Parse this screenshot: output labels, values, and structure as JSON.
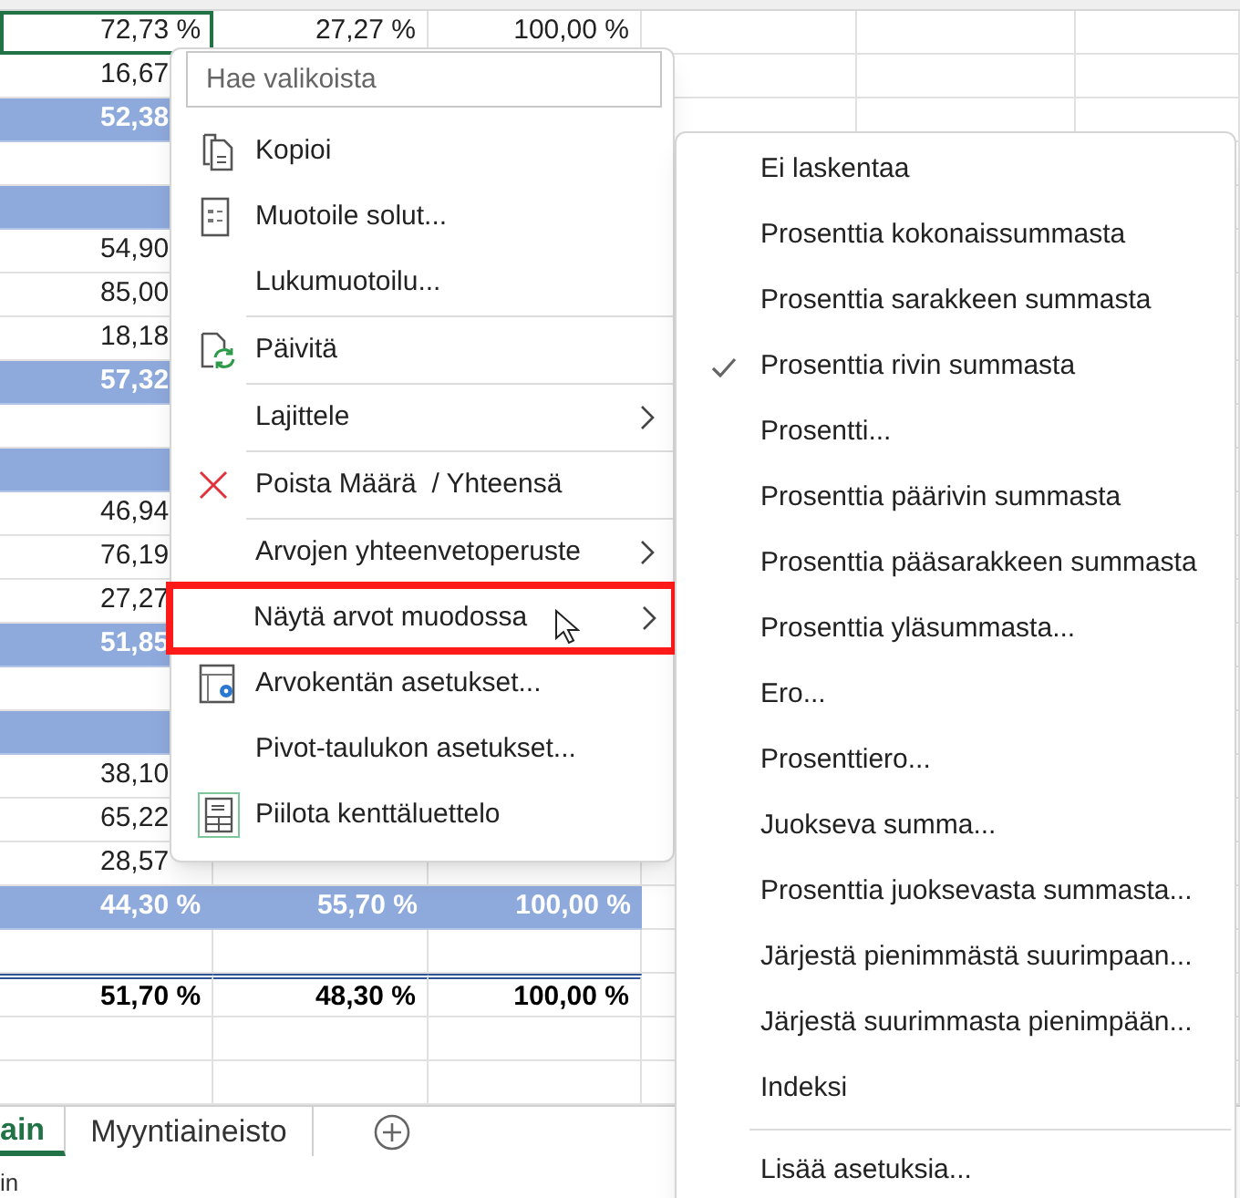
{
  "sheet": {
    "rows": [
      {
        "kind": "value",
        "selected_cell": true,
        "cells": [
          "72,73 %",
          "27,27 %",
          "100,00 %"
        ]
      },
      {
        "kind": "value",
        "cells": [
          "16,67"
        ]
      },
      {
        "kind": "subtotal",
        "cells": [
          "52,38"
        ]
      },
      {
        "kind": "empty",
        "cells": []
      },
      {
        "kind": "header",
        "cells": []
      },
      {
        "kind": "value",
        "cells": [
          "54,90"
        ]
      },
      {
        "kind": "value",
        "cells": [
          "85,00"
        ]
      },
      {
        "kind": "value",
        "cells": [
          "18,18"
        ]
      },
      {
        "kind": "subtotal",
        "cells": [
          "57,32"
        ]
      },
      {
        "kind": "empty",
        "cells": []
      },
      {
        "kind": "header",
        "cells": []
      },
      {
        "kind": "value",
        "cells": [
          "46,94"
        ]
      },
      {
        "kind": "value",
        "cells": [
          "76,19"
        ]
      },
      {
        "kind": "value",
        "cells": [
          "27,27"
        ]
      },
      {
        "kind": "subtotal",
        "cells": [
          "51,85"
        ]
      },
      {
        "kind": "empty",
        "cells": []
      },
      {
        "kind": "header",
        "cells": []
      },
      {
        "kind": "value",
        "cells": [
          "38,10"
        ]
      },
      {
        "kind": "value",
        "cells": [
          "65,22"
        ]
      },
      {
        "kind": "value",
        "cells": [
          "28,57"
        ]
      },
      {
        "kind": "subtotal",
        "cells": [
          "44,30 %",
          "55,70 %",
          "100,00 %"
        ]
      },
      {
        "kind": "empty",
        "cells": []
      },
      {
        "kind": "total",
        "cells": [
          "51,70 %",
          "48,30 %",
          "100,00 %"
        ]
      },
      {
        "kind": "empty",
        "cells": []
      },
      {
        "kind": "empty",
        "cells": []
      }
    ]
  },
  "sheet_tabs": [
    {
      "label": "ain",
      "selected": true
    },
    {
      "label": "Myyntiaineisto",
      "selected": false
    }
  ],
  "status_bar": {
    "text": "in"
  },
  "context_menu": {
    "search": {
      "placeholder": "Hae valikoista"
    },
    "groups": [
      [
        {
          "label": "Kopioi",
          "kind": "copy",
          "submenu": false,
          "highlighted": false
        },
        {
          "label": "Muotoile solut...",
          "kind": "format",
          "submenu": false,
          "highlighted": false
        },
        {
          "label": "Lukumuotoilu...",
          "kind": "plain",
          "submenu": false,
          "highlighted": false
        }
      ],
      [
        {
          "label": "Päivitä",
          "kind": "refresh",
          "submenu": false,
          "highlighted": false
        }
      ],
      [
        {
          "label": "Lajittele",
          "kind": "plain",
          "submenu": true,
          "highlighted": false
        }
      ],
      [
        {
          "label": "Poista Määrä  / Yhteensä",
          "kind": "remove",
          "submenu": false,
          "highlighted": false
        }
      ],
      [
        {
          "label": "Arvojen yhteenvetoperuste",
          "kind": "plain",
          "submenu": true,
          "highlighted": false
        },
        {
          "label": "Näytä arvot muodossa",
          "kind": "plain",
          "submenu": true,
          "highlighted": true
        },
        {
          "label": "Arvokentän asetukset...",
          "kind": "field-settings",
          "submenu": false,
          "highlighted": false
        },
        {
          "label": "Pivot-taulukon asetukset...",
          "kind": "plain",
          "submenu": false,
          "highlighted": false
        },
        {
          "label": "Piilota kenttäluettelo",
          "kind": "field-list",
          "submenu": false,
          "highlighted": false
        }
      ]
    ]
  },
  "submenu": {
    "groups": [
      [
        {
          "label": "Ei laskentaa",
          "checked": false
        },
        {
          "label": "Prosenttia kokonaissummasta",
          "checked": false
        },
        {
          "label": "Prosenttia sarakkeen summasta",
          "checked": false
        },
        {
          "label": "Prosenttia rivin summasta",
          "checked": true
        },
        {
          "label": "Prosentti...",
          "checked": false
        },
        {
          "label": "Prosenttia päärivin summasta",
          "checked": false
        },
        {
          "label": "Prosenttia pääsarakkeen summasta",
          "checked": false
        },
        {
          "label": "Prosenttia yläsummasta...",
          "checked": false
        },
        {
          "label": "Ero...",
          "checked": false
        },
        {
          "label": "Prosenttiero...",
          "checked": false
        },
        {
          "label": "Juokseva summa...",
          "checked": false
        },
        {
          "label": "Prosenttia juoksevasta summasta...",
          "checked": false
        },
        {
          "label": "Järjestä pienimmästä suurimpaan...",
          "checked": false
        },
        {
          "label": "Järjestä suurimmasta pienimpään...",
          "checked": false
        },
        {
          "label": "Indeksi",
          "checked": false
        }
      ],
      [
        {
          "label": "Lisää asetuksia...",
          "checked": false
        }
      ]
    ]
  }
}
